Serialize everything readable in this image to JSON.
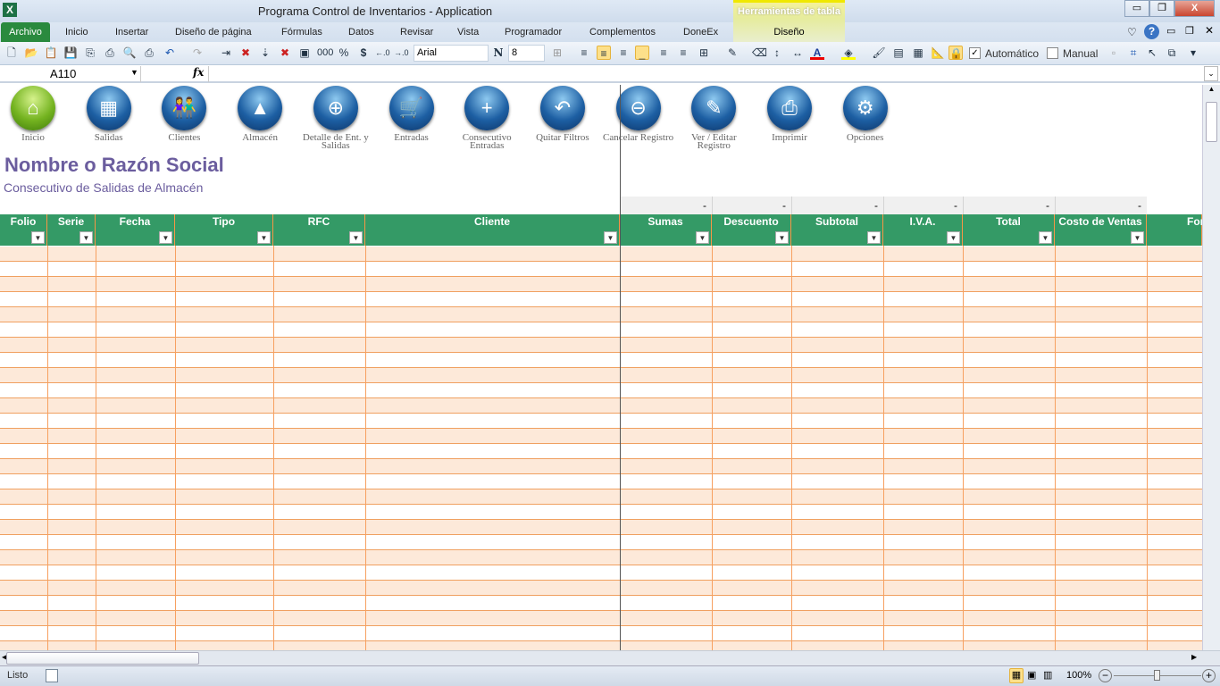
{
  "window": {
    "title": "Programa Control de Inventarios  -  Application",
    "minimize": "▭",
    "restore": "❐",
    "close": "X"
  },
  "ribbon": {
    "file_tab": "Archivo",
    "tabs": [
      "Inicio",
      "Insertar",
      "Diseño de página",
      "Fórmulas",
      "Datos",
      "Revisar",
      "Vista",
      "Programador",
      "Complementos",
      "DoneEx"
    ],
    "context_group": "Herramientas de tabla",
    "context_tab": "Diseño"
  },
  "toolbar": {
    "font": "Arial",
    "size": "8",
    "bold_label": "N",
    "thousands": "000",
    "percent": "%",
    "currency": "$",
    "auto_label": "Automático",
    "manual_label": "Manual"
  },
  "formula_bar": {
    "name_box": "A110",
    "fx": "fx",
    "formula": ""
  },
  "nav_buttons": [
    {
      "label": "Inicio",
      "icon": "home-icon",
      "glyph": "⌂",
      "green": true
    },
    {
      "label": "Salidas",
      "icon": "calculator-icon",
      "glyph": "▦"
    },
    {
      "label": "Clientes",
      "icon": "people-icon",
      "glyph": "👫"
    },
    {
      "label": "Almacén",
      "icon": "warehouse-icon",
      "glyph": "▲"
    },
    {
      "label": "Detalle de Ent. y Salidas",
      "icon": "target-icon",
      "glyph": "⊕"
    },
    {
      "label": "Entradas",
      "icon": "cart-icon",
      "glyph": "🛒"
    },
    {
      "label": "Consecutivo Entradas",
      "icon": "new-document-icon",
      "glyph": "+"
    },
    {
      "label": "Quitar Filtros",
      "icon": "undo-arrow-icon",
      "glyph": "↶"
    },
    {
      "label": "Cancelar Registro",
      "icon": "minus-icon",
      "glyph": "⊖"
    },
    {
      "label": "Ver / Editar Registro",
      "icon": "edit-document-icon",
      "glyph": "✎"
    },
    {
      "label": "Imprimir",
      "icon": "printer-icon",
      "glyph": "⎙"
    },
    {
      "label": "Opciones",
      "icon": "gear-icon",
      "glyph": "⚙"
    }
  ],
  "sheet": {
    "company": "Nombre o Razón Social",
    "subtitle": "Consecutivo de Salidas de Almacén",
    "totals": [
      "-",
      "-",
      "-",
      "-",
      "-",
      "-"
    ],
    "columns": [
      "Folio",
      "Serie",
      "Fecha",
      "Tipo",
      "RFC",
      "Cliente",
      "Sumas",
      "Descuento",
      "Subtotal",
      "I.V.A.",
      "Total",
      "Costo de Ventas",
      "For"
    ]
  },
  "status": {
    "ready": "Listo",
    "zoom": "100%"
  }
}
